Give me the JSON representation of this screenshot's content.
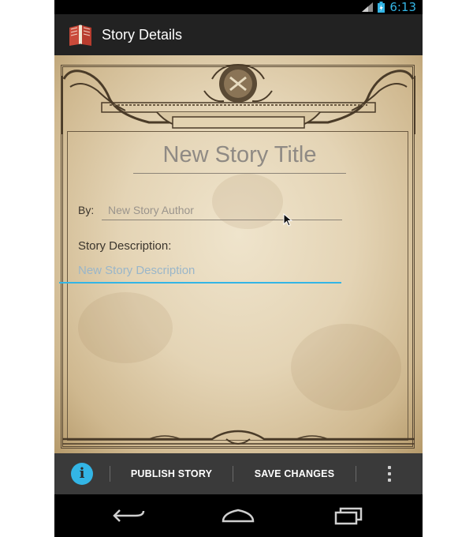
{
  "statusbar": {
    "time": "6:13",
    "accent": "#33b5e5"
  },
  "actionbar": {
    "title": "Story Details",
    "icon": "book-icon"
  },
  "form": {
    "title_placeholder": "New Story Title",
    "by_label": "By:",
    "author_placeholder": "New Story Author",
    "description_label": "Story Description:",
    "description_placeholder": "New Story Description"
  },
  "bottombar": {
    "info_icon": "info-icon",
    "info_glyph": "i",
    "publish_label": "PUBLISH STORY",
    "save_label": "SAVE CHANGES",
    "overflow_icon": "overflow-menu-icon"
  },
  "navbar": {
    "back_icon": "back-icon",
    "home_icon": "home-icon",
    "recents_icon": "recents-icon"
  },
  "colors": {
    "accent": "#33b5e5",
    "actionbar": "#222222",
    "bottombar": "#3a3a3a",
    "parchment": "#e4d4b5"
  }
}
